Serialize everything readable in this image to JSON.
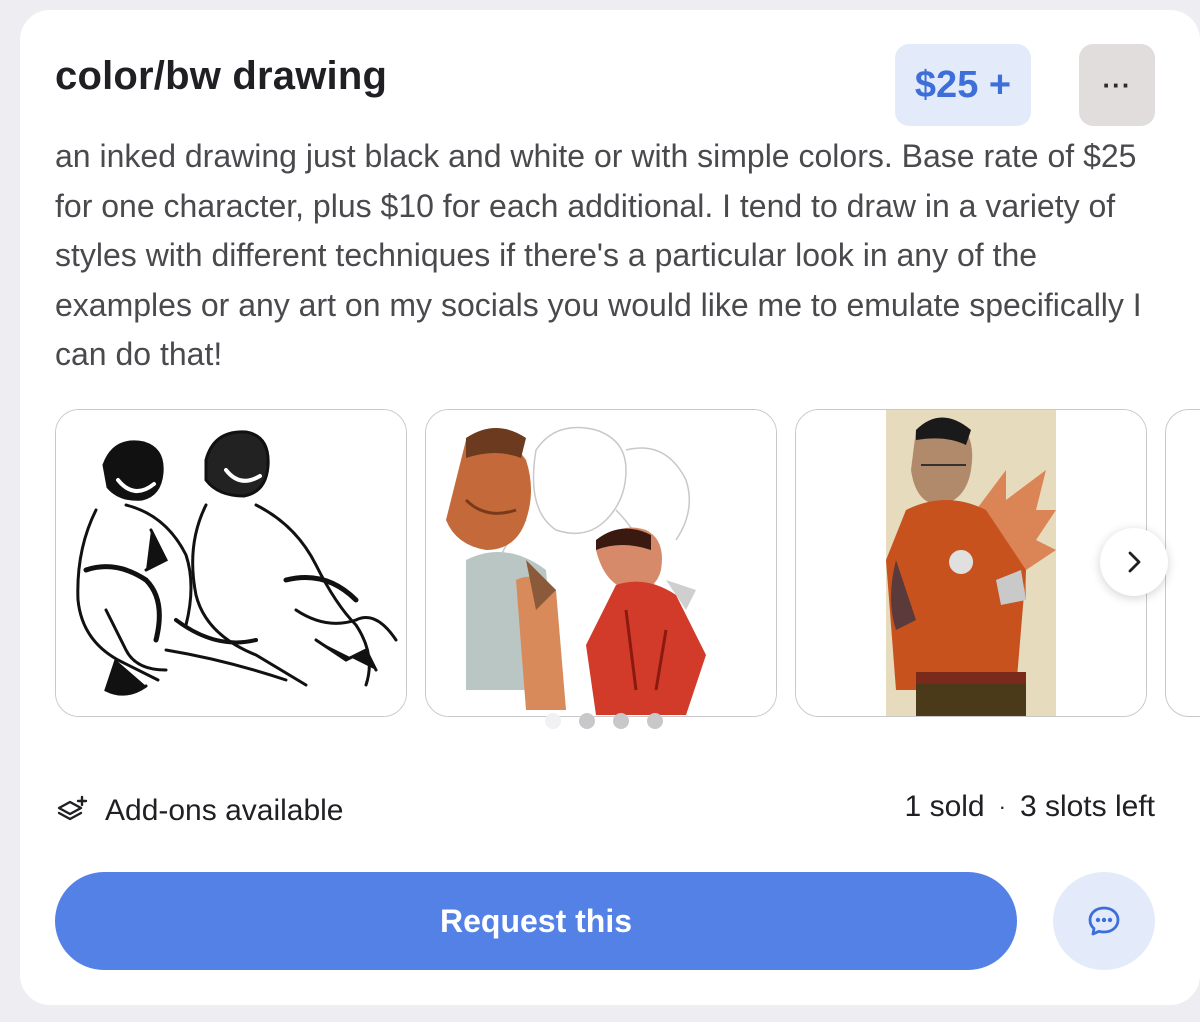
{
  "listing": {
    "title": "color/bw drawing",
    "price": "$25 +",
    "more_label": "···",
    "description": "an inked drawing just black and white or with simple colors. Base rate of $25 for one character, plus $10 for each additional. I tend to draw in a variety of styles with different techniques if there's a particular look in any of the examples or any art on my socials you would like me to emulate specifically I can do that!"
  },
  "gallery": {
    "images": [
      {
        "icon": "ink-sketch-two-men-image"
      },
      {
        "icon": "color-sketch-two-men-image"
      },
      {
        "icon": "man-orange-jacket-image"
      }
    ],
    "next_icon": "chevron-right-icon",
    "page_dots": 4,
    "active_dot": 0
  },
  "meta": {
    "addons_icon": "layers-plus-icon",
    "addons_label": "Add-ons available",
    "sold": "1 sold",
    "separator": "·",
    "slots": "3 slots left"
  },
  "actions": {
    "request_label": "Request this",
    "chat_icon": "chat-bubble-icon"
  },
  "colors": {
    "accent": "#5481e5",
    "price_bg": "#e3ebfb",
    "price_text": "#3e6fd8",
    "more_bg": "#e1dddd"
  }
}
